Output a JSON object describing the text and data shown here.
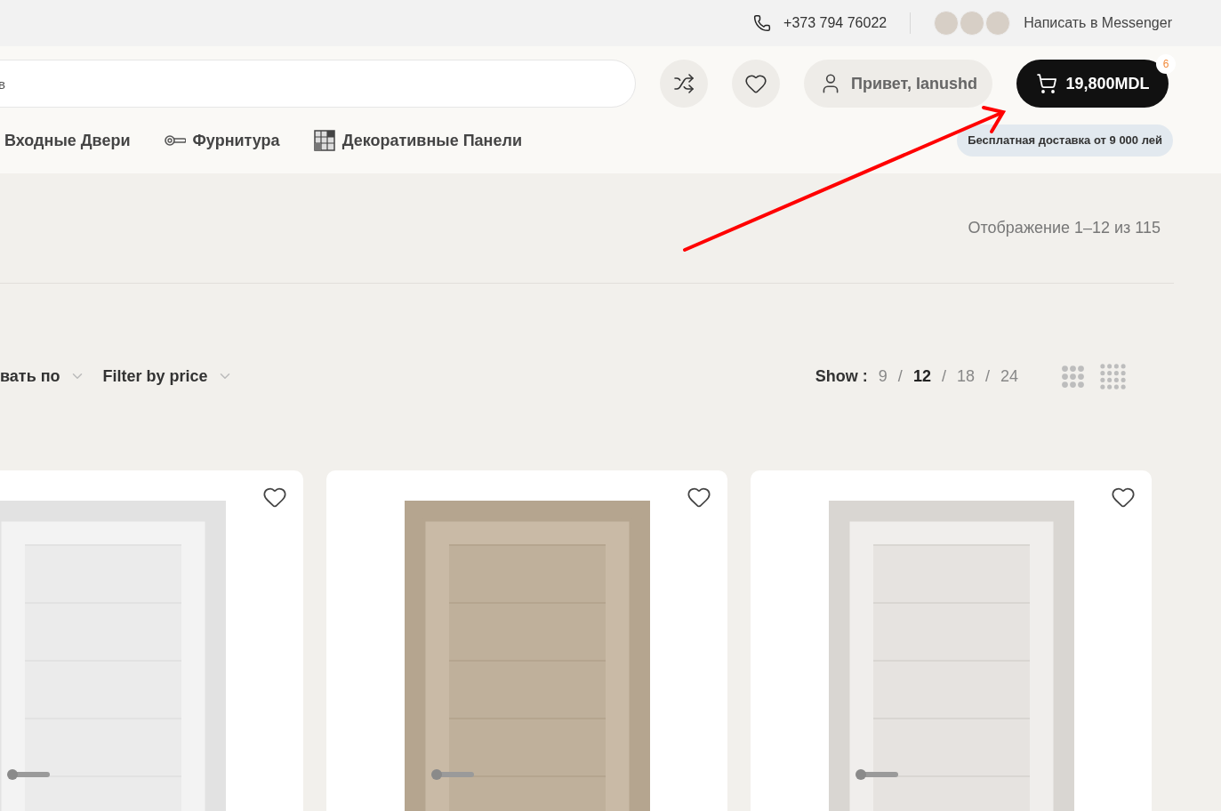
{
  "topbar": {
    "phone": "+373 794 76022",
    "messenger": "Написать в Messenger"
  },
  "header": {
    "search": {
      "placeholder": "в"
    },
    "greeting": "Привет, Ianushd",
    "cart": {
      "total": "19,800MDL",
      "count": "6"
    }
  },
  "nav": [
    {
      "label": "Входные Двери",
      "kind": "plain"
    },
    {
      "label": "Фурнитура",
      "kind": "handle"
    },
    {
      "label": "Декоративные Панели",
      "kind": "panel"
    }
  ],
  "delivery_badge": "Бесплатная доставка от 9 000 лей",
  "result_count": "Отображение 1–12 из 115",
  "filters": [
    "вать по",
    "Filter by price"
  ],
  "show": {
    "label": "Show :",
    "separator": "/",
    "options": [
      {
        "label": "9",
        "selected": false
      },
      {
        "label": "12",
        "selected": true
      },
      {
        "label": "18",
        "selected": false
      },
      {
        "label": "24",
        "selected": false
      }
    ]
  },
  "products": [
    {
      "favorite": false
    },
    {
      "favorite": false
    },
    {
      "favorite": false
    }
  ],
  "annotation": {
    "kind": "arrow",
    "color": "#ff0000"
  }
}
